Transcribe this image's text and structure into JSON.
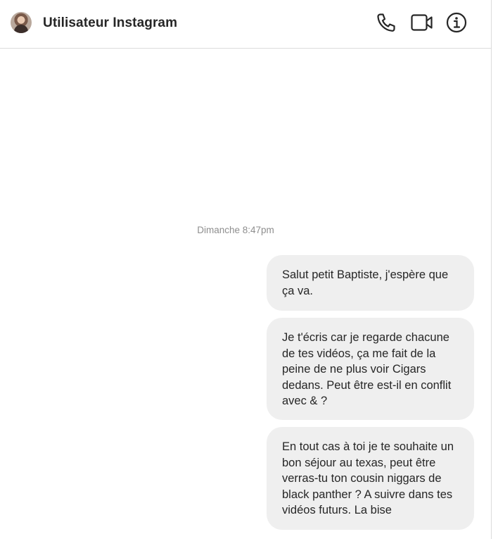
{
  "header": {
    "title": "Utilisateur Instagram",
    "icons": [
      "avatar",
      "phone-icon",
      "video-icon",
      "info-icon"
    ]
  },
  "conversation": {
    "timestamp": "Dimanche 8:47pm",
    "messages": [
      {
        "text": "Salut petit Baptiste, j'espère que ça va."
      },
      {
        "text": "Je t'écris car je regarde chacune de tes vidéos, ça me fait de la peine de ne plus voir Cigars dedans. Peut être est-il en conflit avec & ?"
      },
      {
        "text": "En tout cas à toi je te souhaite un bon séjour au texas, peut être verras-tu ton cousin niggars de black panther ? A suivre dans tes vidéos futurs. La bise"
      }
    ]
  },
  "colors": {
    "bubble_bg": "#efefef",
    "text": "#262626",
    "timestamp": "#8e8e8e",
    "divider": "#dbdbdb"
  }
}
